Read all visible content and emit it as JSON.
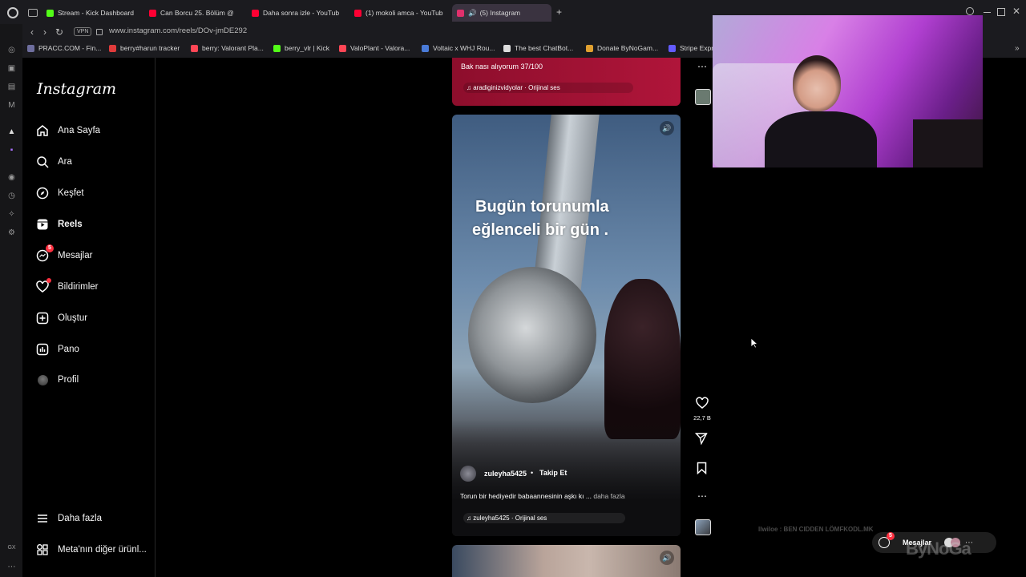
{
  "browser": {
    "tabs": [
      {
        "title": "Stream - Kick Dashboard",
        "color": "#53fc18"
      },
      {
        "title": "Can Borcu 25. Bölüm @",
        "color": "#ff0033"
      },
      {
        "title": "Daha sonra izle - YouTub",
        "color": "#ff0033"
      },
      {
        "title": "(1) mokoli amca - YouTub",
        "color": "#ff0033"
      },
      {
        "title": "(5) Instagram",
        "color": "#e1306c"
      }
    ],
    "new_tab": "+",
    "vpn": "VPN",
    "url": "www.instagram.com/reels/DOv-jmDE292",
    "bookmarks": [
      {
        "label": "PRACC.COM - Fin...",
        "color": "#6e6e9e"
      },
      {
        "label": "berry#harun tracker",
        "color": "#e03b3b"
      },
      {
        "label": "berry: Valorant Pla...",
        "color": "#ff4655"
      },
      {
        "label": "berry_vlr | Kick",
        "color": "#53fc18"
      },
      {
        "label": "ValoPlant - Valora...",
        "color": "#ff4655"
      },
      {
        "label": "Voltaic x WHJ Rou...",
        "color": "#4a7bd8"
      },
      {
        "label": "The best ChatBot...",
        "color": "#dddddd"
      },
      {
        "label": "Donate ByNoGam...",
        "color": "#e0a030"
      },
      {
        "label": "Stripe Expr",
        "color": "#635bff"
      }
    ]
  },
  "instagram": {
    "logo": "Instagram",
    "nav": [
      {
        "label": "Ana Sayfa",
        "icon": "home-icon"
      },
      {
        "label": "Ara",
        "icon": "search-icon"
      },
      {
        "label": "Keşfet",
        "icon": "compass-icon"
      },
      {
        "label": "Reels",
        "icon": "reels-icon"
      },
      {
        "label": "Mesajlar",
        "icon": "messenger-icon",
        "badge": "5"
      },
      {
        "label": "Bildirimler",
        "icon": "heart-icon"
      },
      {
        "label": "Oluştur",
        "icon": "plus-square-icon"
      },
      {
        "label": "Pano",
        "icon": "dashboard-icon"
      },
      {
        "label": "Profil",
        "icon": "avatar-icon"
      }
    ],
    "more": "Daha fazla",
    "meta": "Meta'nın diğer ürünl...",
    "prev_reel": {
      "caption": "Bak nası alıyorum 37/100",
      "audio": "aradiginizvidyolar · Orijinal ses"
    },
    "reel": {
      "overlay_line1": "Bugün torunumla",
      "overlay_line2": "eğlenceli bir gün .",
      "username": "zuleyha5425",
      "follow": "Takip Et",
      "caption": "Torun bir hediyedir babaannesinin aşkı kı ...",
      "more": "daha fazla",
      "audio": "zuleyha5425 · Orijinal ses",
      "likes": "22,7 B"
    }
  },
  "stream_overlay": {
    "chat_line": "llwiloe : BEN CIDDEN LÖMFKODL.MK",
    "messages_label": "Mesajlar",
    "messages_badge": "5",
    "watermark": "ByNoGa"
  },
  "colors": {
    "accent": "#ff3040",
    "prev_reel": "#a8133a"
  }
}
